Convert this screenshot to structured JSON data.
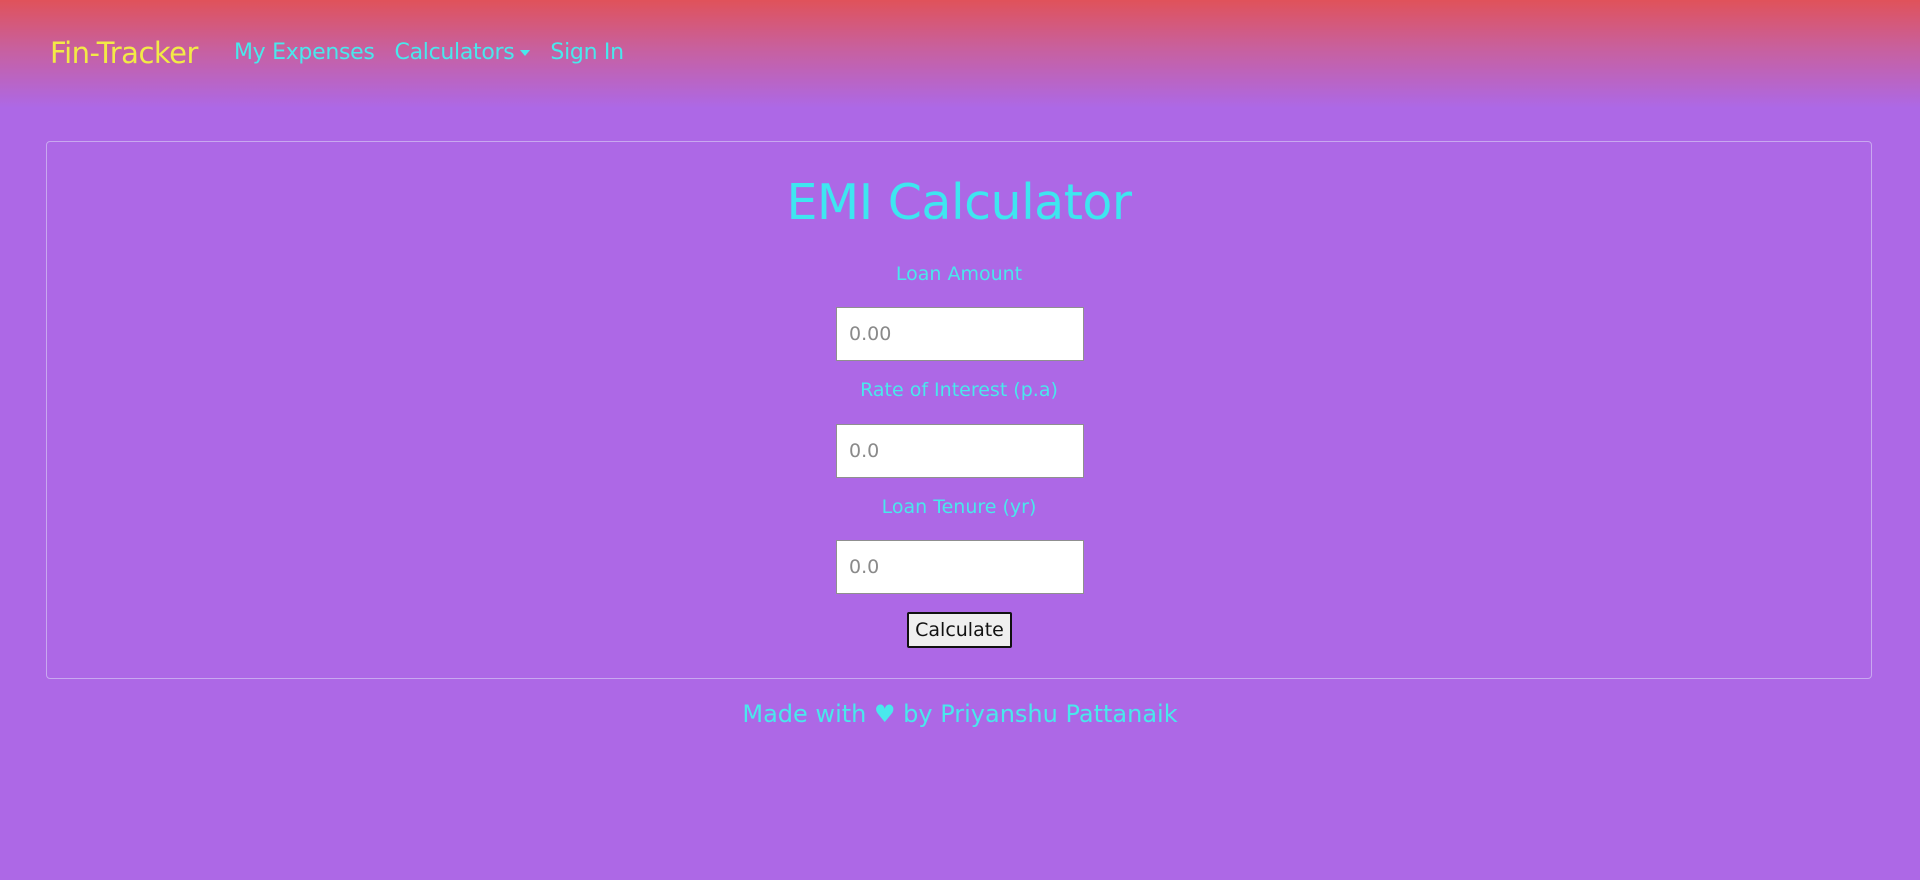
{
  "navbar": {
    "brand": "Fin-Tracker",
    "links": {
      "expenses": "My Expenses",
      "calculators": "Calculators",
      "signin": "Sign In"
    }
  },
  "form": {
    "title": "EMI Calculator",
    "loan_amount": {
      "label": "Loan Amount",
      "placeholder": "0.00",
      "value": ""
    },
    "rate": {
      "label": "Rate of Interest (p.a)",
      "placeholder": "0.0",
      "value": ""
    },
    "tenure": {
      "label": "Loan Tenure (yr)",
      "placeholder": "0.0",
      "value": ""
    },
    "submit_label": "Calculate"
  },
  "footer": {
    "prefix": "Made with",
    "heart": "♥",
    "suffix": "by Priyanshu Pattanaik"
  },
  "colors": {
    "background": "#ad68e6",
    "brand": "#f3ea46",
    "accent": "#49e8ec",
    "header_top": "#e0525a"
  },
  "icons": {
    "dropdown": "caret-down-icon",
    "footer_heart": "heart-icon"
  }
}
